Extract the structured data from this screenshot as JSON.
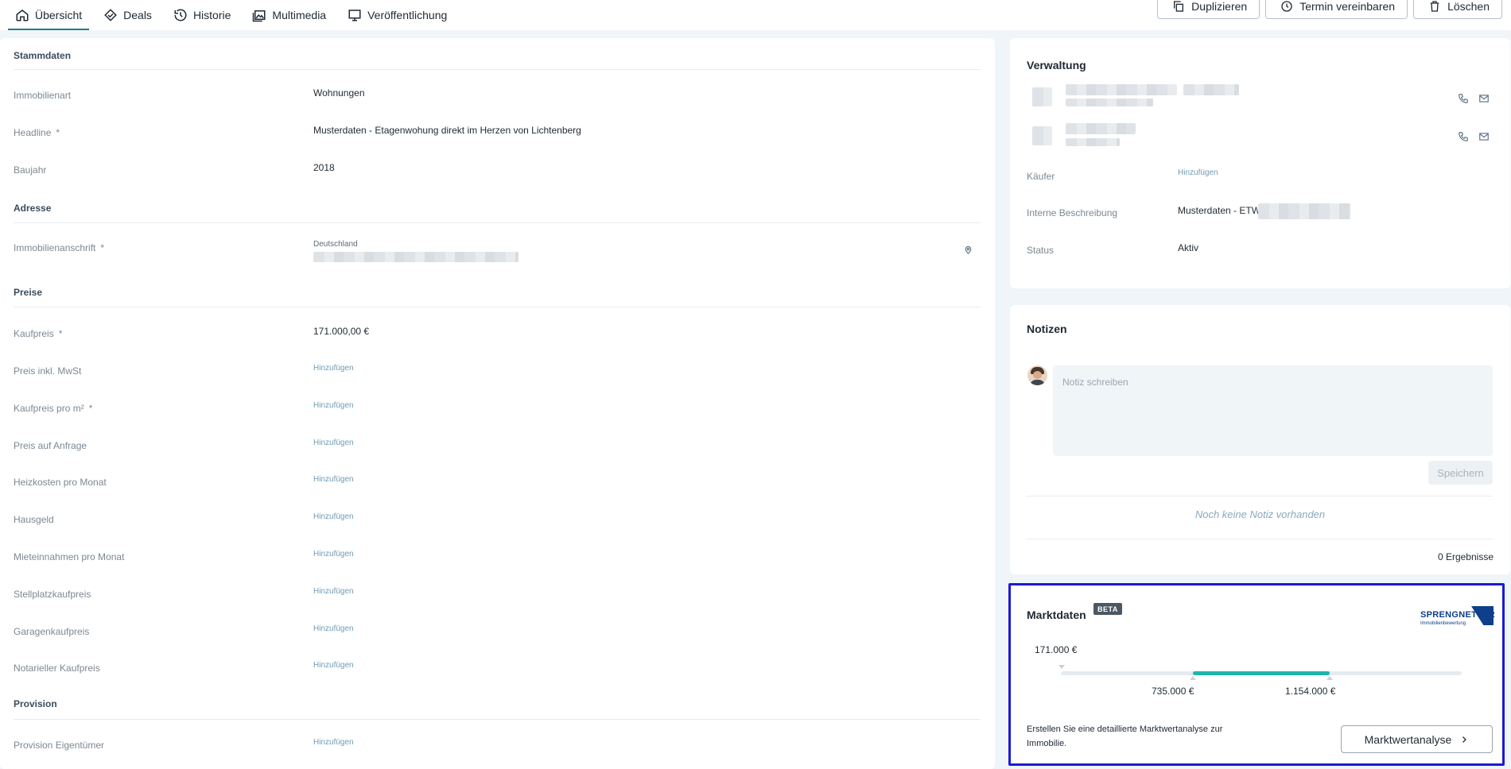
{
  "tabs": [
    {
      "label": "Übersicht",
      "icon": "home-icon",
      "active": true
    },
    {
      "label": "Deals",
      "icon": "handshake-icon"
    },
    {
      "label": "Historie",
      "icon": "history-icon"
    },
    {
      "label": "Multimedia",
      "icon": "gallery-icon"
    },
    {
      "label": "Veröffentlichung",
      "icon": "monitor-icon"
    }
  ],
  "actions": {
    "duplicate": "Duplizieren",
    "schedule": "Termin vereinbaren",
    "delete": "Löschen"
  },
  "stammdaten": {
    "title": "Stammdaten",
    "immobilienart_label": "Immobilienart",
    "immobilienart_value": "Wohnungen",
    "headline_label": "Headline",
    "headline_value": "Musterdaten - Etagenwohung direkt im Herzen von Lichtenberg",
    "baujahr_label": "Baujahr",
    "baujahr_value": "2018"
  },
  "adresse": {
    "title": "Adresse",
    "anschrift_label": "Immobilienanschrift",
    "country": "Deutschland"
  },
  "preise": {
    "title": "Preise",
    "kaufpreis_label": "Kaufpreis",
    "kaufpreis_value": "171.000,00 €",
    "add_label": "Hinzufügen",
    "fields": [
      "Preis inkl. MwSt",
      "Kaufpreis pro m²",
      "Preis auf Anfrage",
      "Heizkosten pro Monat",
      "Hausgeld",
      "Mieteinnahmen pro Monat",
      "Stellplatzkaufpreis",
      "Garagenkaufpreis",
      "Notarieller Kaufpreis"
    ]
  },
  "provision": {
    "title": "Provision",
    "eigentuemer_label": "Provision Eigentümer"
  },
  "required_mark": "*",
  "verwaltung": {
    "title": "Verwaltung",
    "kaeufer_label": "Käufer",
    "kaeufer_value": "Hinzufügen",
    "beschreibung_label": "Interne Beschreibung",
    "beschreibung_value": "Musterdaten - ETW",
    "status_label": "Status",
    "status_value": "Aktiv"
  },
  "notizen": {
    "title": "Notizen",
    "placeholder": "Notiz schreiben",
    "save_label": "Speichern",
    "empty_text": "Noch keine Notiz vorhanden",
    "result_count": "0 Ergebnisse"
  },
  "marktdaten": {
    "title": "Marktdaten",
    "badge": "BETA",
    "logo_text": "SPRENGNETTER",
    "logo_sub": "Immobilienbewertung",
    "current_price": "171.000 €",
    "range_low": "735.000 €",
    "range_high": "1.154.000 €",
    "description": "Erstellen Sie eine detaillierte Marktwertanalyse zur Immobilie.",
    "button_label": "Marktwertanalyse",
    "range_start_fraction": 0.33,
    "range_end_fraction": 0.67,
    "accent_color": "#1fb5ad"
  },
  "colors": {
    "active_tab": "#1d7d86",
    "highlight_border": "#1a1ad6"
  }
}
